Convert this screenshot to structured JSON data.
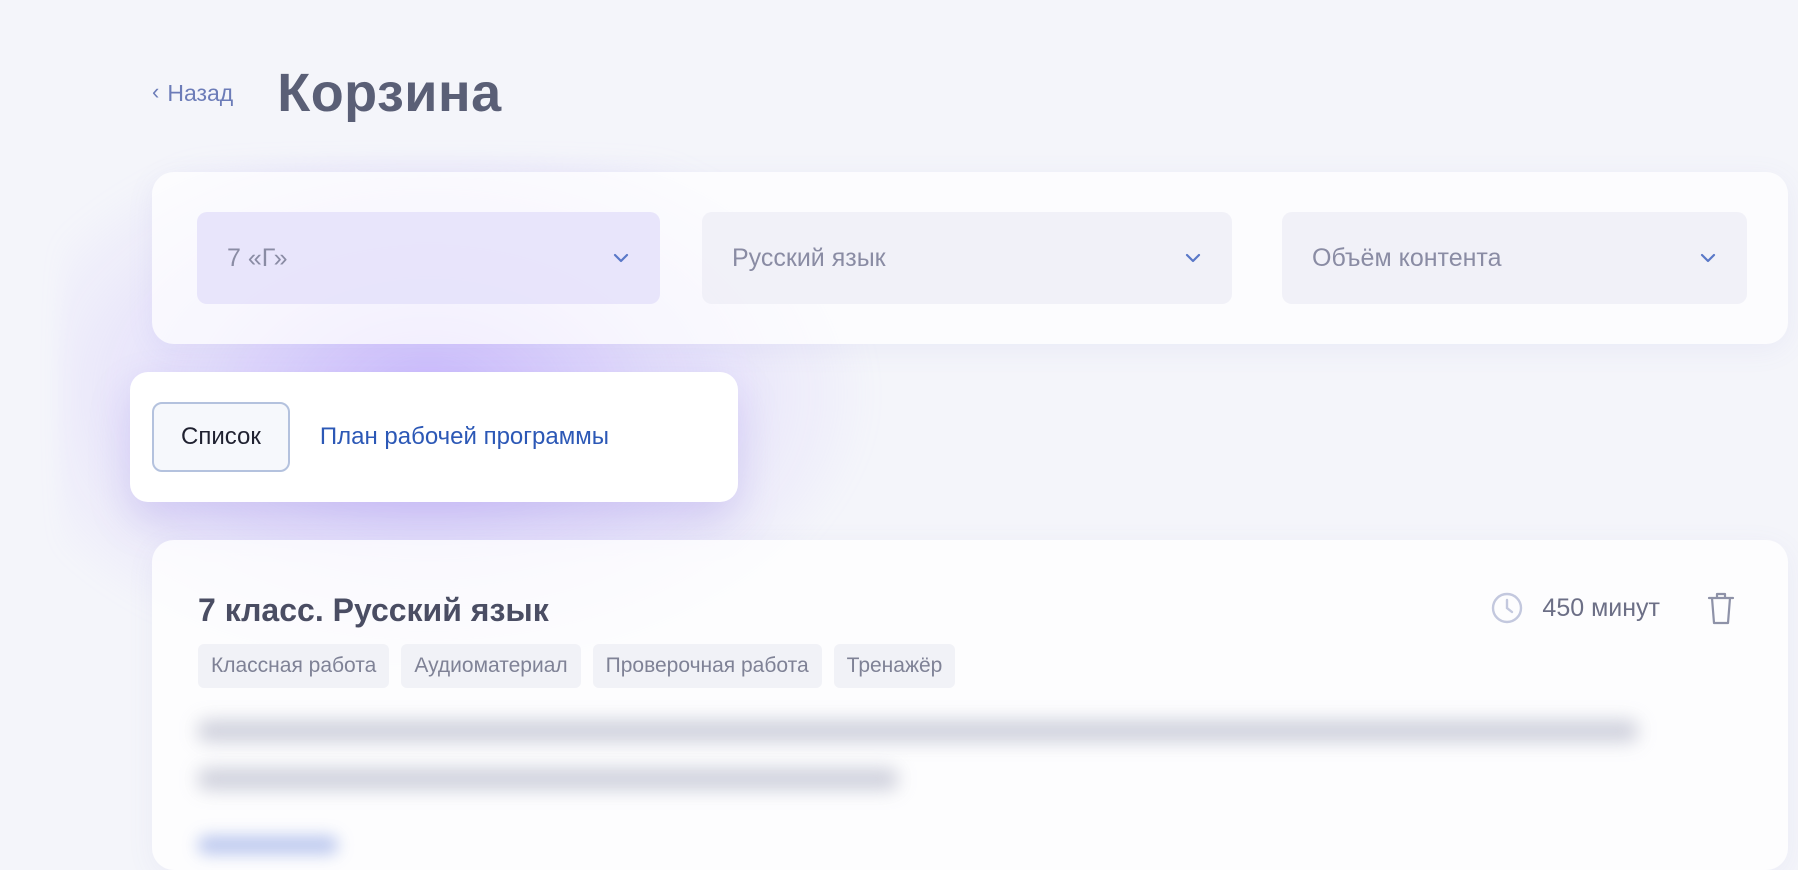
{
  "header": {
    "back_label": "Назад",
    "title": "Корзина"
  },
  "filters": {
    "class_select": {
      "value": "7 «Г»"
    },
    "subject_select": {
      "value": "Русский язык"
    },
    "volume_select": {
      "placeholder": "Объём контента"
    }
  },
  "view_tabs": {
    "list_label": "Список",
    "plan_label": "План рабочей программы",
    "selected": "Список"
  },
  "course": {
    "title": "7 класс. Русский язык",
    "duration": "450 минут",
    "tags": [
      "Классная работа",
      "Аудиоматериал",
      "Проверочная работа",
      "Тренажёр"
    ]
  },
  "colors": {
    "accent": "#2c58b6",
    "background": "#f4f5fa",
    "glow": "#aa8cff"
  },
  "icons": {
    "back": "chevron-left-icon",
    "select_arrow": "chevron-down-icon",
    "duration": "clock-icon",
    "delete": "trash-icon"
  }
}
